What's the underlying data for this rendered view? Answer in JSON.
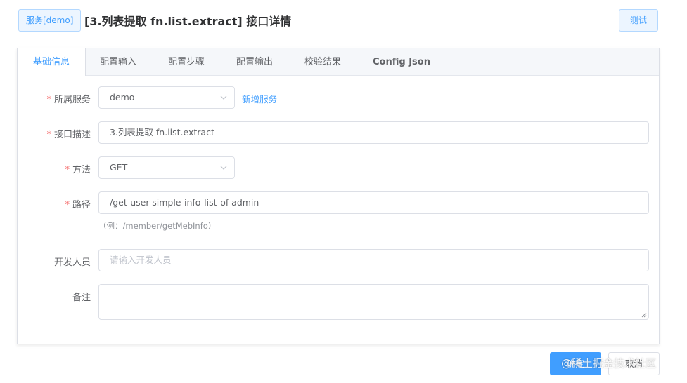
{
  "header": {
    "service_tag": "服务[demo]",
    "title": "[3.列表提取 fn.list.extract] 接口详情",
    "test_button": "测试"
  },
  "tabs": [
    {
      "label": "基础信息",
      "active": true
    },
    {
      "label": "配置输入",
      "active": false
    },
    {
      "label": "配置步骤",
      "active": false
    },
    {
      "label": "配置输出",
      "active": false
    },
    {
      "label": "校验结果",
      "active": false
    },
    {
      "label": "Config Json",
      "active": false
    }
  ],
  "form": {
    "service": {
      "label": "所属服务",
      "required": true,
      "value": "demo",
      "add_link": "新增服务"
    },
    "description": {
      "label": "接口描述",
      "required": true,
      "value": "3.列表提取 fn.list.extract"
    },
    "method": {
      "label": "方法",
      "required": true,
      "value": "GET"
    },
    "path": {
      "label": "路径",
      "required": true,
      "value": "/get-user-simple-info-list-of-admin",
      "hint": "（例：/member/getMebInfo）"
    },
    "developer": {
      "label": "开发人员",
      "required": false,
      "value": "",
      "placeholder": "请输入开发人员"
    },
    "remark": {
      "label": "备注",
      "required": false,
      "value": ""
    }
  },
  "footer": {
    "confirm_button": "确定",
    "cancel_button": "取消",
    "watermark": "@稀土掘金技术社区"
  },
  "required_mark": "*",
  "colors": {
    "primary": "#409eff",
    "required": "#f56c6c",
    "border": "#dcdfe6"
  }
}
